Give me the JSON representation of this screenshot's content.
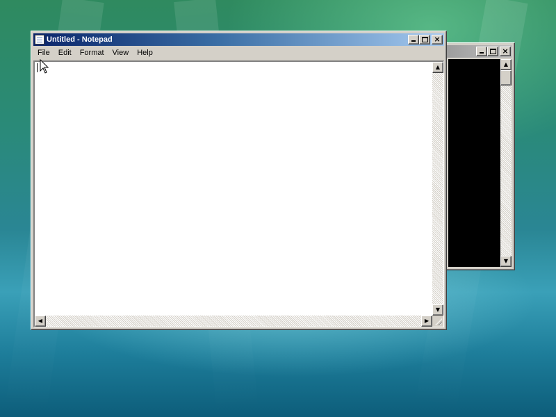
{
  "desktop": {
    "accent": "#2a8a8a"
  },
  "notepad": {
    "title": "Untitled - Notepad",
    "icon": "notepad-icon",
    "menu": [
      "File",
      "Edit",
      "Format",
      "View",
      "Help"
    ],
    "content": "",
    "title_gradient": [
      "#0a246a",
      "#a6caf0"
    ]
  },
  "console": {
    "title": "",
    "background": "#000000"
  },
  "caption_buttons": {
    "minimize": "minimize-icon",
    "maximize": "maximize-icon",
    "close": "×"
  },
  "scroll_glyphs": {
    "up": "▲",
    "down": "▼",
    "left": "◀",
    "right": "▶"
  }
}
